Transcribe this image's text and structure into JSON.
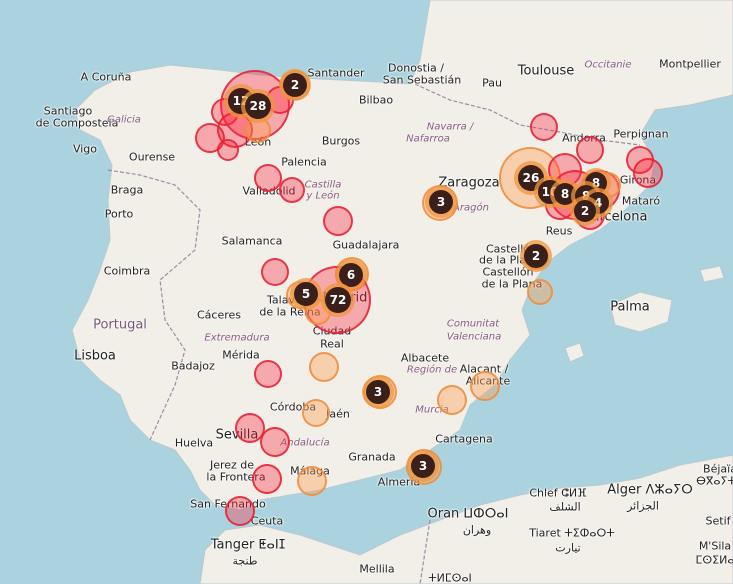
{
  "map": {
    "colors": {
      "sea": "#aad3df",
      "land": "#f2efe9",
      "red_marker": "#e61e32",
      "orange_marker": "#f08c3c",
      "cluster": "#3a1f1a"
    },
    "labels": [
      {
        "id": "a-coruna",
        "text": "A Coruña",
        "kind": "city"
      },
      {
        "id": "santiago",
        "text": "Santiago",
        "kind": "city"
      },
      {
        "id": "de-compostela",
        "text": "de Compostela",
        "kind": "city"
      },
      {
        "id": "galicia",
        "text": "Galicia",
        "kind": "region"
      },
      {
        "id": "vigo",
        "text": "Vigo",
        "kind": "city"
      },
      {
        "id": "ourense",
        "text": "Ourense",
        "kind": "city"
      },
      {
        "id": "braga",
        "text": "Braga",
        "kind": "city"
      },
      {
        "id": "porto",
        "text": "Porto",
        "kind": "city"
      },
      {
        "id": "coimbra",
        "text": "Coimbra",
        "kind": "city"
      },
      {
        "id": "portugal",
        "text": "Portugal",
        "kind": "country"
      },
      {
        "id": "lisboa",
        "text": "Lisboa",
        "kind": "city"
      },
      {
        "id": "santander",
        "text": "Santander",
        "kind": "city"
      },
      {
        "id": "donostia",
        "text": "Donostia /",
        "kind": "city"
      },
      {
        "id": "san-sebastian",
        "text": "San Sebastián",
        "kind": "city"
      },
      {
        "id": "bilbao",
        "text": "Bilbao",
        "kind": "city"
      },
      {
        "id": "pau",
        "text": "Pau",
        "kind": "city"
      },
      {
        "id": "toulouse",
        "text": "Toulouse",
        "kind": "city"
      },
      {
        "id": "occitanie",
        "text": "Occitanie",
        "kind": "region"
      },
      {
        "id": "montpellier",
        "text": "Montpellier",
        "kind": "city"
      },
      {
        "id": "navarra",
        "text": "Navarra /",
        "kind": "region"
      },
      {
        "id": "nafarroa",
        "text": "Nafarroa",
        "kind": "region"
      },
      {
        "id": "burgos",
        "text": "Burgos",
        "kind": "city"
      },
      {
        "id": "leon",
        "text": "León",
        "kind": "city"
      },
      {
        "id": "palencia",
        "text": "Palencia",
        "kind": "city"
      },
      {
        "id": "castilla",
        "text": "Castilla",
        "kind": "region"
      },
      {
        "id": "y-leon",
        "text": "y León",
        "kind": "region"
      },
      {
        "id": "valladolid",
        "text": "Valladolid",
        "kind": "city"
      },
      {
        "id": "andorra",
        "text": "Andorra",
        "kind": "city"
      },
      {
        "id": "perpignan",
        "text": "Perpignan",
        "kind": "city"
      },
      {
        "id": "girona",
        "text": "Girona",
        "kind": "city"
      },
      {
        "id": "mataro",
        "text": "Mataró",
        "kind": "city"
      },
      {
        "id": "zaragoza",
        "text": "Zaragoza",
        "kind": "city"
      },
      {
        "id": "aragon",
        "text": "Aragón",
        "kind": "region"
      },
      {
        "id": "barcelona",
        "text": "Barcelona",
        "kind": "city"
      },
      {
        "id": "reus",
        "text": "Reus",
        "kind": "city"
      },
      {
        "id": "salamanca",
        "text": "Salamanca",
        "kind": "city"
      },
      {
        "id": "guadalajara",
        "text": "Guadalajara",
        "kind": "city"
      },
      {
        "id": "madrid",
        "text": "Madrid",
        "kind": "city"
      },
      {
        "id": "talavera",
        "text": "Talavera",
        "kind": "city"
      },
      {
        "id": "de-la-reina",
        "text": "de la Reina",
        "kind": "city"
      },
      {
        "id": "ciudad",
        "text": "Ciudad",
        "kind": "city"
      },
      {
        "id": "real",
        "text": "Real",
        "kind": "city"
      },
      {
        "id": "caceres",
        "text": "Cáceres",
        "kind": "city"
      },
      {
        "id": "extremadura",
        "text": "Extremadura",
        "kind": "region"
      },
      {
        "id": "merida",
        "text": "Mérida",
        "kind": "city"
      },
      {
        "id": "badajoz",
        "text": "Badajoz",
        "kind": "city"
      },
      {
        "id": "castello",
        "text": "Castelló",
        "kind": "city"
      },
      {
        "id": "de-la-plana",
        "text": "de la Plana /",
        "kind": "city"
      },
      {
        "id": "castellon",
        "text": "Castellón",
        "kind": "city"
      },
      {
        "id": "de-la-plana2",
        "text": "de la Plana",
        "kind": "city"
      },
      {
        "id": "comunitat",
        "text": "Comunitat",
        "kind": "region"
      },
      {
        "id": "valenciana",
        "text": "Valenciana",
        "kind": "region"
      },
      {
        "id": "palma",
        "text": "Palma",
        "kind": "city"
      },
      {
        "id": "albacete",
        "text": "Albacete",
        "kind": "city"
      },
      {
        "id": "alacant",
        "text": "Alacant /",
        "kind": "city"
      },
      {
        "id": "alicante",
        "text": "Alicante",
        "kind": "city"
      },
      {
        "id": "region-de",
        "text": "Región de",
        "kind": "region"
      },
      {
        "id": "murcia",
        "text": "Murcia",
        "kind": "region"
      },
      {
        "id": "cartagena",
        "text": "Cartagena",
        "kind": "city"
      },
      {
        "id": "cordoba",
        "text": "Córdoba",
        "kind": "city"
      },
      {
        "id": "jaen",
        "text": "Jaén",
        "kind": "city"
      },
      {
        "id": "sevilla",
        "text": "Sevilla",
        "kind": "city"
      },
      {
        "id": "andalucia",
        "text": "Andalucía",
        "kind": "region"
      },
      {
        "id": "huelva",
        "text": "Huelva",
        "kind": "city"
      },
      {
        "id": "granada",
        "text": "Granada",
        "kind": "city"
      },
      {
        "id": "jerez",
        "text": "Jerez de",
        "kind": "city"
      },
      {
        "id": "la-frontera",
        "text": "la Frontera",
        "kind": "city"
      },
      {
        "id": "malaga",
        "text": "Málaga",
        "kind": "city"
      },
      {
        "id": "almeria",
        "text": "Almería",
        "kind": "city"
      },
      {
        "id": "san-fernando",
        "text": "San Fernando",
        "kind": "city"
      },
      {
        "id": "ceuta",
        "text": "Ceuta",
        "kind": "city"
      },
      {
        "id": "tanger",
        "text": "Tanger ⵟⴰⵏⵊ",
        "kind": "city"
      },
      {
        "id": "tanger-ar",
        "text": "طنجة",
        "kind": "city"
      },
      {
        "id": "oran",
        "text": "Oran ⵡⵀⵔⴰⵏ",
        "kind": "city"
      },
      {
        "id": "oran-ar",
        "text": "وهران",
        "kind": "city"
      },
      {
        "id": "chlef",
        "text": "Chlef ⵛⵍⴼ",
        "kind": "city"
      },
      {
        "id": "chlef-ar",
        "text": "الشلف",
        "kind": "city"
      },
      {
        "id": "alger",
        "text": "Alger ⴷⵣⴰⵢⵔ",
        "kind": "city"
      },
      {
        "id": "alger-ar",
        "text": "الجزائر",
        "kind": "city"
      },
      {
        "id": "tiaret",
        "text": "Tiaret ⵜⵉⵀⴰⵔⵜ",
        "kind": "city"
      },
      {
        "id": "tiaret-ar",
        "text": "تيارت",
        "kind": "city"
      },
      {
        "id": "bejaia",
        "text": "Béjaïa",
        "kind": "city"
      },
      {
        "id": "bejaia-tz",
        "text": "ⴱⴳⴰⵢⵜ",
        "kind": "city"
      },
      {
        "id": "setif",
        "text": "Setif",
        "kind": "city"
      },
      {
        "id": "msila",
        "text": "M'Sila",
        "kind": "city"
      },
      {
        "id": "msila-tz",
        "text": "ⵎⵙⵉⵍⴰ",
        "kind": "city"
      },
      {
        "id": "mellila",
        "text": "Mellila",
        "kind": "city"
      },
      {
        "id": "tlemcen",
        "text": "ⵜⵍⵎⵙⴰⵏ",
        "kind": "city"
      }
    ],
    "clusters": [
      {
        "id": "leon-12",
        "count": "12"
      },
      {
        "id": "leon-28",
        "count": "28"
      },
      {
        "id": "santander-2",
        "count": "2"
      },
      {
        "id": "zaragoza-3",
        "count": "3"
      },
      {
        "id": "lleida-26",
        "count": "26"
      },
      {
        "id": "bcn-10",
        "count": "10"
      },
      {
        "id": "bcn-8a",
        "count": "8"
      },
      {
        "id": "bcn-8b",
        "count": "8"
      },
      {
        "id": "bcn-8c",
        "count": "8"
      },
      {
        "id": "bcn-4",
        "count": "4"
      },
      {
        "id": "bcn-2",
        "count": "2"
      },
      {
        "id": "castello-2",
        "count": "2"
      },
      {
        "id": "madrid-6",
        "count": "6"
      },
      {
        "id": "madrid-5",
        "count": "5"
      },
      {
        "id": "madrid-72",
        "count": "72"
      },
      {
        "id": "jaen-3",
        "count": "3"
      },
      {
        "id": "almeria-3",
        "count": "3"
      }
    ]
  }
}
